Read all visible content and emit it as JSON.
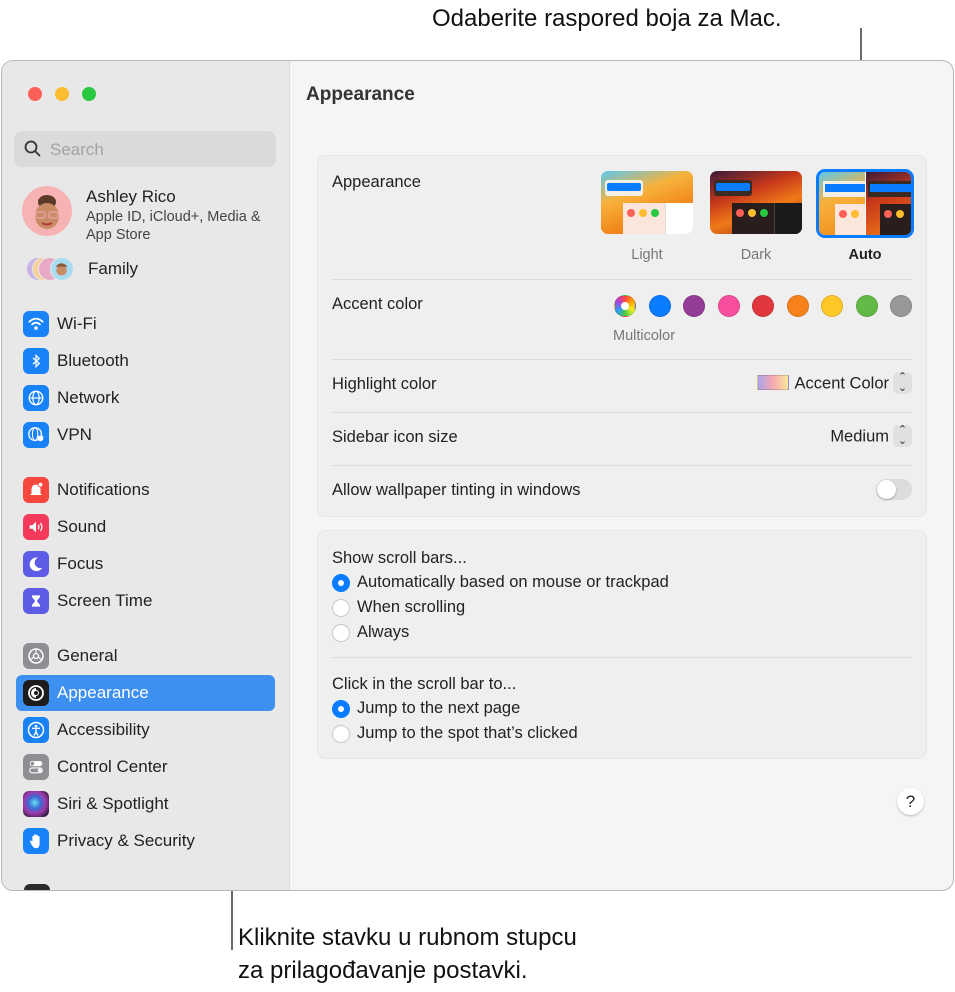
{
  "callouts": {
    "top": "Odaberite raspored boja za Mac.",
    "bottom_line1": "Kliknite stavku u rubnom stupcu",
    "bottom_line2": "za prilagođavanje postavki."
  },
  "window": {
    "traffic_lights": {
      "close": "#fe5f57",
      "minimize": "#febc2e",
      "zoom": "#28c840"
    }
  },
  "sidebar": {
    "search_placeholder": "Search",
    "user": {
      "name": "Ashley Rico",
      "subtitle": "Apple ID, iCloud+, Media & App Store"
    },
    "family_label": "Family",
    "items": [
      {
        "label": "Wi-Fi",
        "icon": "wifi-icon",
        "color": "#1a82f7"
      },
      {
        "label": "Bluetooth",
        "icon": "bluetooth-icon",
        "color": "#1a82f7"
      },
      {
        "label": "Network",
        "icon": "globe-icon",
        "color": "#1a82f7"
      },
      {
        "label": "VPN",
        "icon": "vpn-globe-icon",
        "color": "#1a82f7"
      },
      {
        "label": "Notifications",
        "icon": "bell-icon",
        "color": "#f6473e"
      },
      {
        "label": "Sound",
        "icon": "speaker-icon",
        "color": "#f43a5b"
      },
      {
        "label": "Focus",
        "icon": "moon-icon",
        "color": "#5e5ce6"
      },
      {
        "label": "Screen Time",
        "icon": "hourglass-icon",
        "color": "#5e5ce6"
      },
      {
        "label": "General",
        "icon": "gear-icon",
        "color": "#8e8e93"
      },
      {
        "label": "Appearance",
        "icon": "appearance-icon",
        "color": "#1c1c1e",
        "selected": true
      },
      {
        "label": "Accessibility",
        "icon": "accessibility-icon",
        "color": "#1a82f7"
      },
      {
        "label": "Control Center",
        "icon": "toggles-icon",
        "color": "#8e8e93"
      },
      {
        "label": "Siri & Spotlight",
        "icon": "siri-icon",
        "color": "#7a3a8c"
      },
      {
        "label": "Privacy & Security",
        "icon": "hand-icon",
        "color": "#1a82f7"
      }
    ],
    "selected_color": "#3d8ff0"
  },
  "main": {
    "title": "Appearance",
    "appearance": {
      "label": "Appearance",
      "options": [
        {
          "label": "Light",
          "selected": false
        },
        {
          "label": "Dark",
          "selected": false
        },
        {
          "label": "Auto",
          "selected": true
        }
      ]
    },
    "accent": {
      "label": "Accent color",
      "selected_name": "Multicolor",
      "swatches": [
        {
          "name": "Multicolor",
          "color": "multicolor",
          "selected": true
        },
        {
          "name": "Blue",
          "color": "#0a7cff"
        },
        {
          "name": "Purple",
          "color": "#953d96"
        },
        {
          "name": "Pink",
          "color": "#f74f9e"
        },
        {
          "name": "Red",
          "color": "#e0383e"
        },
        {
          "name": "Orange",
          "color": "#f7821b"
        },
        {
          "name": "Yellow",
          "color": "#ffc726"
        },
        {
          "name": "Green",
          "color": "#62ba46"
        },
        {
          "name": "Graphite",
          "color": "#989898"
        }
      ]
    },
    "highlight": {
      "label": "Highlight color",
      "value": "Accent Color"
    },
    "sidebar_icon_size": {
      "label": "Sidebar icon size",
      "value": "Medium"
    },
    "wallpaper_tinting": {
      "label": "Allow wallpaper tinting in windows",
      "enabled": false
    },
    "scroll_bars": {
      "label": "Show scroll bars...",
      "options": [
        {
          "label": "Automatically based on mouse or trackpad",
          "selected": true
        },
        {
          "label": "When scrolling",
          "selected": false
        },
        {
          "label": "Always",
          "selected": false
        }
      ]
    },
    "click_scroll": {
      "label": "Click in the scroll bar to...",
      "options": [
        {
          "label": "Jump to the next page",
          "selected": true
        },
        {
          "label": "Jump to the spot that’s clicked",
          "selected": false
        }
      ]
    },
    "help_label": "?"
  }
}
